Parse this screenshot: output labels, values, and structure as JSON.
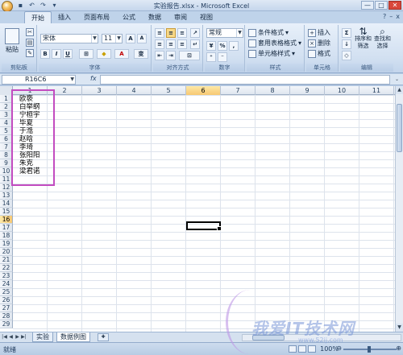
{
  "window": {
    "title": "实验报告.xlsx - Microsoft Excel",
    "qat_icons": [
      "save-icon",
      "undo-icon",
      "redo-icon",
      "customize-icon"
    ],
    "controls": [
      "—",
      "□",
      "✕"
    ]
  },
  "ribbon": {
    "tabs": [
      "开始",
      "插入",
      "页面布局",
      "公式",
      "数据",
      "审阅",
      "视图"
    ],
    "active_tab": "开始",
    "groups": {
      "clipboard": {
        "label": "剪贴板",
        "paste": "粘贴"
      },
      "font": {
        "label": "字体",
        "font_name": "宋体",
        "font_size": "11",
        "bold": "B",
        "italic": "I",
        "underline": "U",
        "grow": "A",
        "shrink": "A",
        "phonetic": "变"
      },
      "alignment": {
        "label": "对齐方式"
      },
      "number": {
        "label": "数字",
        "format": "常规",
        "percent": "%",
        "comma": ","
      },
      "styles": {
        "label": "样式",
        "conditional": "条件格式",
        "table": "套用表格格式",
        "cell": "单元格样式"
      },
      "cells": {
        "label": "单元格",
        "insert": "插入",
        "delete": "删除",
        "format": "格式"
      },
      "editing": {
        "label": "编辑",
        "sum": "Σ",
        "sort": "排序和\n筛选",
        "find": "查找和\n选择"
      }
    }
  },
  "formula_bar": {
    "name_box": "R16C6",
    "fx": "fx",
    "formula": ""
  },
  "grid": {
    "columns": [
      "1",
      "2",
      "3",
      "4",
      "5",
      "6",
      "7",
      "8",
      "9",
      "10",
      "11"
    ],
    "selected_column": "6",
    "rows": [
      "1",
      "2",
      "3",
      "4",
      "5",
      "6",
      "7",
      "8",
      "9",
      "10",
      "11",
      "12",
      "13",
      "14",
      "15",
      "16",
      "17",
      "18",
      "19",
      "20",
      "21",
      "22",
      "23",
      "24",
      "25",
      "26",
      "27",
      "28",
      "29"
    ],
    "selected_row": "16",
    "column_a_values": [
      "欧亵",
      "白举纲",
      "宁桓宇",
      "毕夏",
      "于湉",
      "赵晗",
      "李琦",
      "张阳阳",
      "朱克",
      "梁君诺"
    ]
  },
  "sheets": {
    "tabs": [
      "实验",
      "数据例图"
    ],
    "active": "数据例图"
  },
  "status": {
    "ready": "就绪",
    "zoom": "100%"
  },
  "watermark": {
    "text": "我爱IT技术网",
    "sub": "www.52ij.com"
  }
}
